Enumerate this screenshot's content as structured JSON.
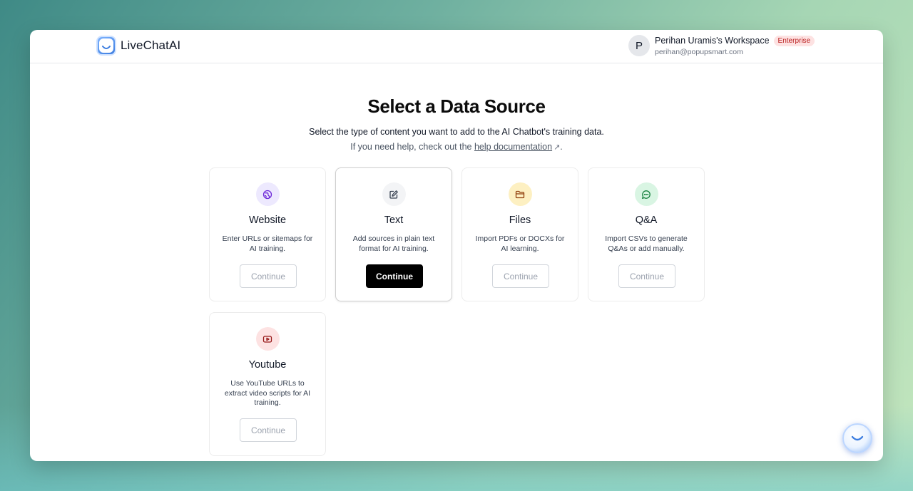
{
  "brand": {
    "name": "LiveChatAI"
  },
  "account": {
    "initial": "P",
    "workspace": "Perihan Uramis's Workspace",
    "plan_badge": "Enterprise",
    "email": "perihan@popupsmart.com"
  },
  "page": {
    "title": "Select a Data Source",
    "subtitle": "Select the type of content you want to add to the AI Chatbot's training data.",
    "help_prefix": "If you need help, check out the",
    "help_link": "help documentation",
    "help_suffix": "."
  },
  "sources": [
    {
      "title": "Website",
      "desc": "Enter URLs or sitemaps for AI training.",
      "button": "Continue",
      "icon": "globe-icon",
      "icon_bg": "#ede9fe",
      "icon_color": "#6d28d9"
    },
    {
      "title": "Text",
      "desc": "Add sources in plain text format for AI training.",
      "button": "Continue",
      "icon": "edit-icon",
      "icon_bg": "#f3f4f6",
      "icon_color": "#374151",
      "selected": true
    },
    {
      "title": "Files",
      "desc": "Import PDFs or DOCXs for AI learning.",
      "button": "Continue",
      "icon": "folder-icon",
      "icon_bg": "#fdf0c2",
      "icon_color": "#92400e"
    },
    {
      "title": "Q&A",
      "desc": "Import CSVs to generate Q&As or add manually.",
      "button": "Continue",
      "icon": "chat-bubble-icon",
      "icon_bg": "#d9f5e3",
      "icon_color": "#15803d"
    },
    {
      "title": "Youtube",
      "desc": "Use YouTube URLs to extract video scripts for AI training.",
      "button": "Continue",
      "icon": "play-icon",
      "icon_bg": "#fde2e2",
      "icon_color": "#991b1b"
    }
  ]
}
